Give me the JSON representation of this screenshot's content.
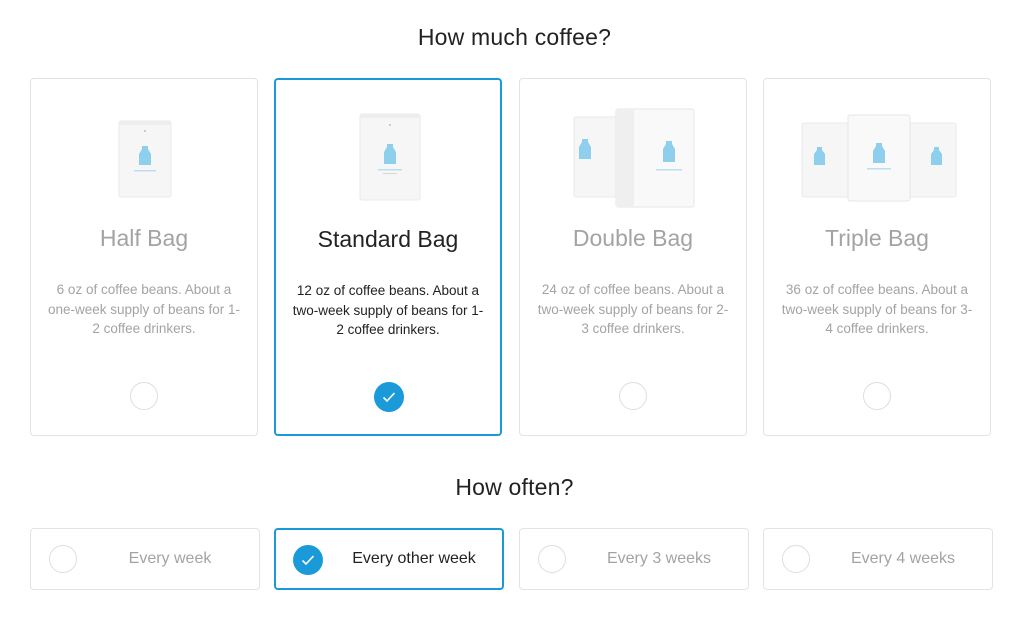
{
  "quantity": {
    "heading": "How much coffee?",
    "options": [
      {
        "title": "Half Bag",
        "description": "6 oz of coffee beans. About a one-week supply of beans for 1-2 coffee drinkers.",
        "image": "single-small-bag",
        "selected": false
      },
      {
        "title": "Standard Bag",
        "description": "12 oz of coffee beans. About a two-week supply of beans for 1-2 coffee drinkers.",
        "image": "single-bag",
        "selected": true
      },
      {
        "title": "Double Bag",
        "description": "24 oz of coffee beans. About a two-week supply of beans for 2-3 coffee drinkers.",
        "image": "two-bags",
        "selected": false
      },
      {
        "title": "Triple Bag",
        "description": "36 oz of coffee beans. About a two-week supply of beans for 3-4 coffee drinkers.",
        "image": "three-bags",
        "selected": false
      }
    ]
  },
  "frequency": {
    "heading": "How often?",
    "options": [
      {
        "label": "Every week",
        "selected": false
      },
      {
        "label": "Every other week",
        "selected": true
      },
      {
        "label": "Every 3 weeks",
        "selected": false
      },
      {
        "label": "Every 4 weeks",
        "selected": false
      }
    ]
  },
  "bag_label": "BLUE BOTTLE",
  "colors": {
    "accent": "#1a9ad9",
    "bottle": "#8ecfee",
    "muted_text": "#a3a3a3",
    "border": "#e3e3e3"
  }
}
